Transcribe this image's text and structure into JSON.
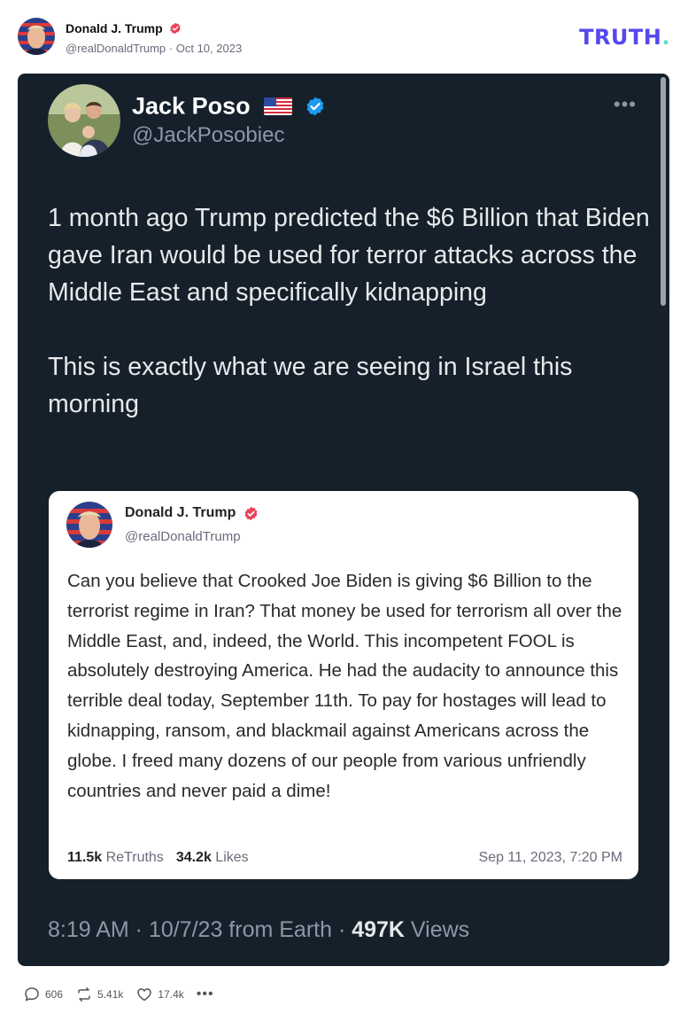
{
  "post": {
    "author_name": "Donald J. Trump",
    "author_handle": "@realDonaldTrump",
    "date": "Oct 10, 2023",
    "brand": "TRUTH",
    "brand_dot": "."
  },
  "embedded_tweet": {
    "name": "Jack Poso",
    "handle": "@JackPosobiec",
    "more": "•••",
    "text": "1 month ago Trump predicted the $6 Billion that Biden gave Iran would be used for terror attacks across the Middle East and specifically kidnapping\n\nThis is exactly what we are seeing in Israel this morning",
    "footer_time": "8:19 AM · 10/7/23 from Earth · ",
    "footer_views_count": "497K",
    "footer_views_label": " Views"
  },
  "quoted_post": {
    "name": "Donald J. Trump",
    "handle": "@realDonaldTrump",
    "text": "Can you believe that Crooked Joe Biden is giving $6 Billion to the terrorist regime in Iran? That money be used for terrorism all over the Middle East, and, indeed, the World. This incompetent FOOL is absolutely destroying America. He had the audacity to announce this terrible deal today, September 11th. To pay for hostages will lead to kidnapping, ransom, and blackmail against Americans across the globe. I freed many dozens of our people from various unfriendly countries and never paid a dime!",
    "retruths_count": "11.5k",
    "retruths_label": " ReTruths",
    "likes_count": "34.2k",
    "likes_label": " Likes",
    "date": "Sep 11, 2023, 7:20 PM"
  },
  "actions": {
    "replies": "606",
    "retruths": "5.41k",
    "likes": "17.4k",
    "more": "•••"
  },
  "icons": [
    "verified-badge-icon",
    "us-flag-icon",
    "verified-check-icon",
    "reply-icon",
    "retruth-icon",
    "like-icon",
    "more-icon"
  ],
  "colors": {
    "brand": "#5448ee",
    "brand_accent": "#5de3c4",
    "tweet_bg": "#15202b",
    "verified_blue": "#1d9bf0",
    "truth_badge": "#e8435a"
  }
}
